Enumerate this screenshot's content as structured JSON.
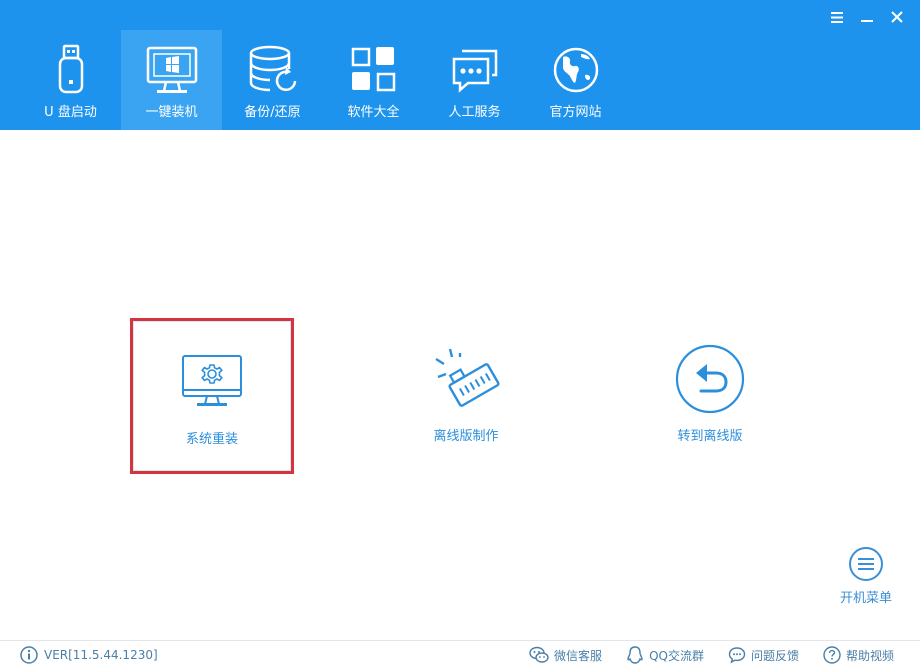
{
  "window": {
    "menu_icon": "hamburger-icon",
    "minimize_icon": "minimize-icon",
    "close_icon": "close-icon"
  },
  "nav": {
    "items": [
      {
        "label": "U 盘启动",
        "icon": "usb-drive-icon"
      },
      {
        "label": "一键装机",
        "icon": "monitor-windows-icon",
        "active": true
      },
      {
        "label": "备份/还原",
        "icon": "database-restore-icon"
      },
      {
        "label": "软件大全",
        "icon": "app-grid-icon"
      },
      {
        "label": "人工服务",
        "icon": "chat-bubble-icon"
      },
      {
        "label": "官方网站",
        "icon": "globe-icon"
      }
    ]
  },
  "main": {
    "cards": [
      {
        "label": "系统重装",
        "icon": "monitor-gear-icon",
        "selected": true
      },
      {
        "label": "离线版制作",
        "icon": "network-plug-icon"
      },
      {
        "label": "转到离线版",
        "icon": "circle-return-icon"
      }
    ],
    "boot_menu": {
      "label": "开机菜单",
      "icon": "circle-menu-icon"
    }
  },
  "footer": {
    "version": "VER[11.5.44.1230]",
    "links": [
      {
        "label": "微信客服",
        "icon": "wechat-icon"
      },
      {
        "label": "QQ交流群",
        "icon": "qq-icon"
      },
      {
        "label": "问题反馈",
        "icon": "feedback-bubble-icon"
      },
      {
        "label": "帮助视频",
        "icon": "help-circle-icon"
      }
    ]
  },
  "colors": {
    "header_bg": "#1e93ee",
    "nav_active_bg": "#3aa4f3",
    "accent_text": "#2b8fdc",
    "selection_border": "#d6333c"
  }
}
